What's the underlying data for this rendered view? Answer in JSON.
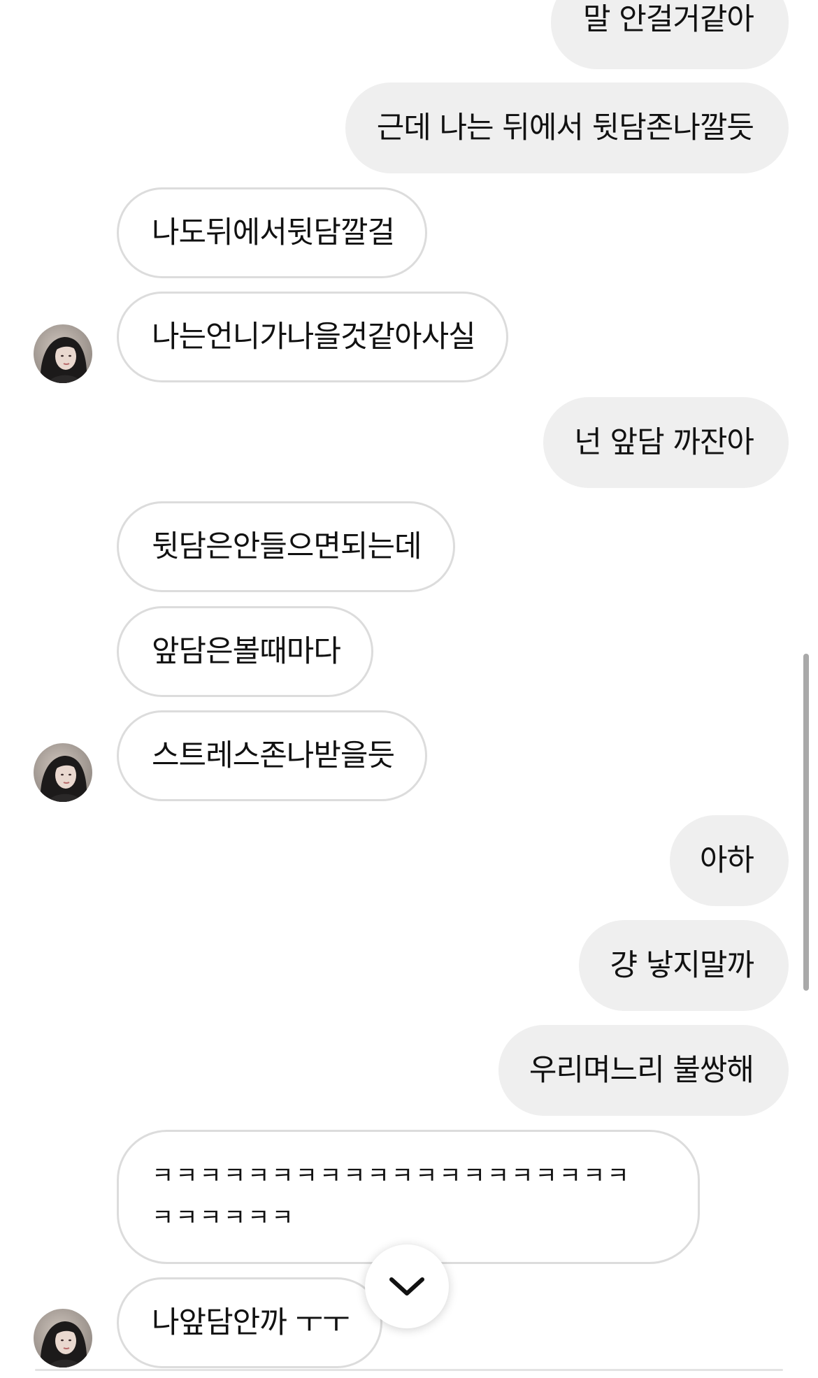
{
  "messages": [
    {
      "sender": "me",
      "text": "말 안걸거같아"
    },
    {
      "sender": "me",
      "text": "근데 나는 뒤에서 뒷담존나깔듯"
    },
    {
      "sender": "them",
      "text": "나도뒤에서뒷담깔걸"
    },
    {
      "sender": "them",
      "text": "나는언니가나을것같아사실"
    },
    {
      "sender": "me",
      "text": "넌 앞담 까잔아"
    },
    {
      "sender": "them",
      "text": "뒷담은안들으면되는데"
    },
    {
      "sender": "them",
      "text": "앞담은볼때마다"
    },
    {
      "sender": "them",
      "text": "스트레스존나받을듯"
    },
    {
      "sender": "me",
      "text": "아하"
    },
    {
      "sender": "me",
      "text": "걍 낳지말까"
    },
    {
      "sender": "me",
      "text": "우리며느리 불쌍해"
    },
    {
      "sender": "them",
      "text": "ㅋㅋㅋㅋㅋㅋㅋㅋㅋㅋㅋㅋㅋㅋㅋㅋㅋㅋㅋㅋ ㅋㅋㅋㅋㅋㅋ"
    },
    {
      "sender": "them",
      "text": "나앞담안까 ㅜㅜ"
    }
  ],
  "icons": {
    "avatar": "contact-avatar",
    "scroll_down": "chevron-down-icon"
  },
  "colors": {
    "my_bubble_bg": "#efefef",
    "their_bubble_border": "#dcdcdc",
    "text": "#111111",
    "scrollbar": "#a9a9a9"
  }
}
